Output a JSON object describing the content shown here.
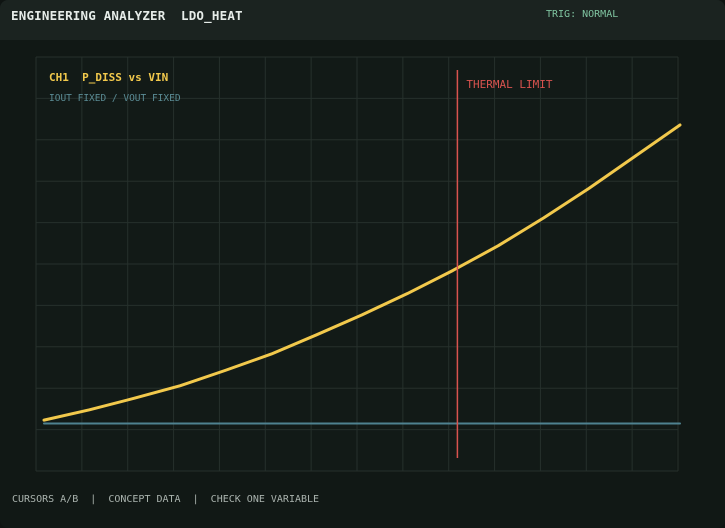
{
  "header": {
    "title": "ENGINEERING ANALYZER  LDO_HEAT",
    "trigger_status": "TRIG: NORMAL"
  },
  "footer": {
    "status": "CURSORS A/B  |  CONCEPT DATA  |  CHECK ONE VARIABLE"
  },
  "colors": {
    "accent": "#f2c94c",
    "baseline": "#4f8290",
    "limit": "#d9534f",
    "grid": "#26302c",
    "background": "#111815"
  },
  "chart_data": {
    "type": "line",
    "title": "CH1  P_DISS vs VIN",
    "subtitle": "IOUT FIXED / VOUT FIXED",
    "xlabel": "",
    "ylabel": "",
    "xlim": [
      0,
      14
    ],
    "ylim": [
      0,
      10
    ],
    "grid": true,
    "series": [
      {
        "name": "",
        "x": [
          0,
          1,
          2,
          3,
          4,
          5,
          6,
          7,
          8,
          9,
          10,
          11,
          12,
          13,
          14
        ],
        "values": [
          0.2,
          0.5,
          0.84,
          1.2,
          1.65,
          2.12,
          2.68,
          3.26,
          3.88,
          4.55,
          5.27,
          6.08,
          6.94,
          7.86,
          8.78
        ],
        "color": "#f2c94c"
      },
      {
        "name": "",
        "x": [
          0,
          14
        ],
        "values": [
          0.1,
          0.1
        ],
        "color": "#4f8290"
      }
    ],
    "annotations": [
      {
        "type": "vline",
        "x": 9.1,
        "label": "THERMAL LIMIT",
        "color": "#d9534f"
      }
    ]
  }
}
